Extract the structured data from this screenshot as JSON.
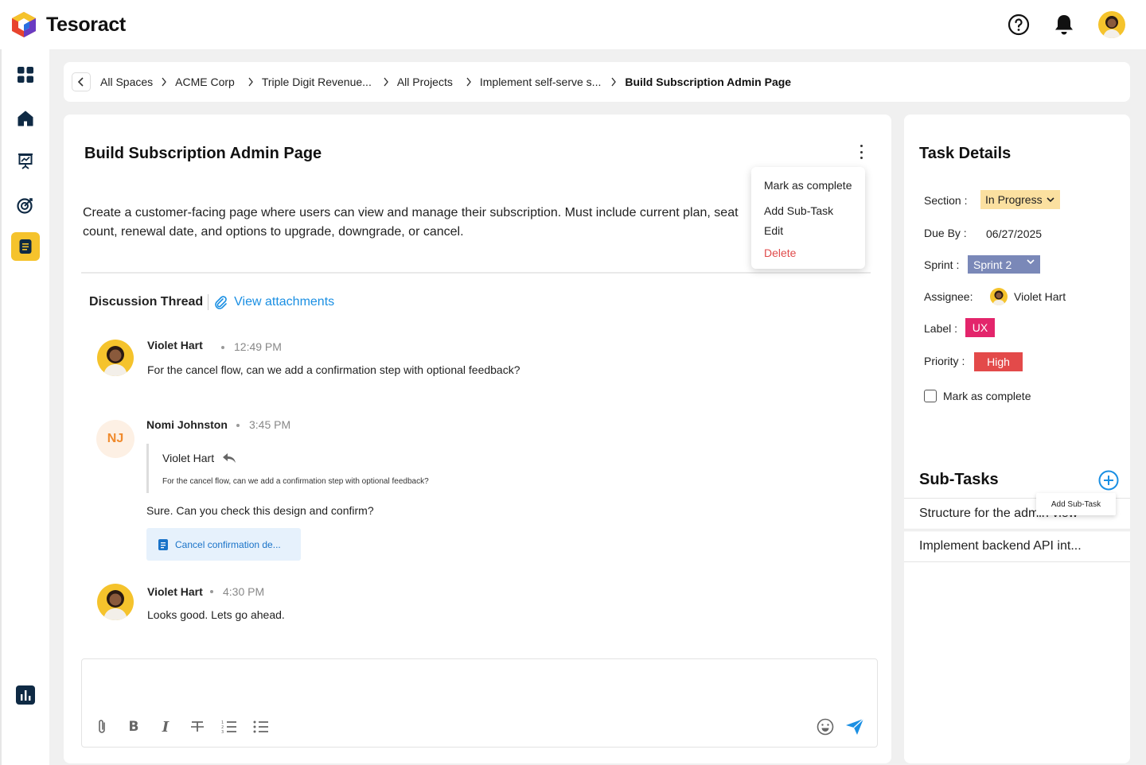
{
  "app": {
    "name": "Tesoract"
  },
  "breadcrumb": [
    "All Spaces",
    "ACME Corp",
    "Triple Digit Revenue...",
    "All Projects",
    "Implement self-serve s...",
    "Build Subscription Admin Page"
  ],
  "task": {
    "title": "Build Subscription Admin Page",
    "description": "Create a customer-facing page where users can view and manage their subscription. Must include current plan, seat count, renewal date, and options to upgrade, downgrade, or cancel."
  },
  "menu": {
    "mark_complete": "Mark as complete",
    "add_subtask": "Add Sub-Task",
    "edit": "Edit",
    "delete": "Delete"
  },
  "thread": {
    "title": "Discussion Thread",
    "attachments_link": "View attachments",
    "messages": [
      {
        "name": "Violet Hart",
        "time": "12:49 PM",
        "text": "For the cancel flow, can we add a confirmation step with optional feedback?"
      },
      {
        "name": "Nomi Johnston",
        "initials": "NJ",
        "time": "3:45 PM",
        "reply_to_name": "Violet Hart",
        "reply_to_text": "For the cancel flow, can we add a confirmation step with optional feedback?",
        "text": "Sure. Can you check this design and confirm?",
        "attachment": "Cancel confirmation de..."
      },
      {
        "name": "Violet Hart",
        "time": "4:30 PM",
        "text": "Looks good. Lets go ahead."
      }
    ]
  },
  "details": {
    "title": "Task Details",
    "section_label": "Section :",
    "section_value": "In Progress",
    "due_label": "Due By :",
    "due_value": "06/27/2025",
    "sprint_label": "Sprint :",
    "sprint_value": "Sprint 2",
    "assignee_label": "Assignee:",
    "assignee_value": "Violet Hart",
    "label_label": "Label :",
    "label_value": "UX",
    "priority_label": "Priority :",
    "priority_value": "High",
    "mark_complete": "Mark as complete"
  },
  "subtasks": {
    "title": "Sub-Tasks",
    "add_tooltip": "Add Sub-Task",
    "items": [
      "Structure for the admin view",
      "Implement backend API int..."
    ]
  },
  "colors": {
    "accent_yellow": "#f5c32c",
    "link_blue": "#1a8fe3",
    "label_ux": "#e3256b",
    "priority_high": "#e34a4a",
    "sprint": "#7a88b8",
    "section": "#fbe0a0",
    "delete": "#e04b4b"
  },
  "icons": {
    "topbar": [
      "help-icon",
      "bell-icon"
    ],
    "sidebar": [
      "dashboard-icon",
      "home-icon",
      "presentation-icon",
      "target-icon",
      "document-icon",
      "analytics-icon"
    ],
    "composer": [
      "paperclip-icon",
      "bold-icon",
      "italic-icon",
      "strikethrough-icon",
      "numbered-list-icon",
      "bullet-list-icon",
      "emoji-icon",
      "send-icon"
    ]
  }
}
